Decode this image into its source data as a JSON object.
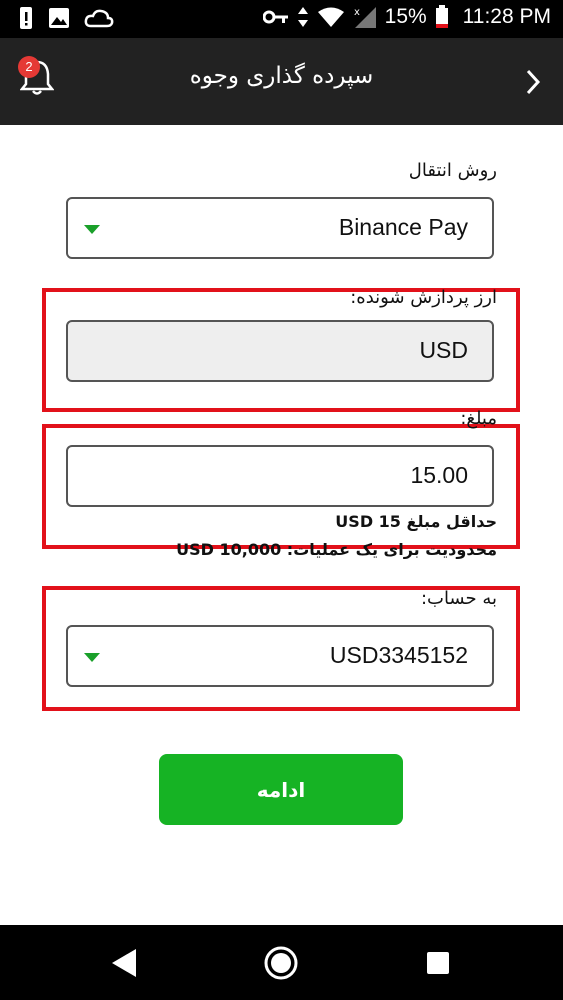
{
  "status_bar": {
    "battery_percent": "15%",
    "time": "11:28 PM"
  },
  "app_bar": {
    "title": "سپرده گذاری وجوه",
    "notification_count": "2"
  },
  "form": {
    "method_label": "روش انتقال",
    "method_value": "Binance Pay",
    "currency_label": "ارز پردازش شونده:",
    "currency_value": "USD",
    "amount_label": "مبلغ:",
    "amount_value": "15.00",
    "min_amount": "حداقل مبلغ USD 15",
    "max_amount": "محدودیت برای یک عملیات: USD 10,000",
    "account_label": "به حساب:",
    "account_value": "USD3345152"
  },
  "actions": {
    "continue_label": "ادامه"
  },
  "colors": {
    "accent_green": "#16b324",
    "highlight_red": "#e2111a",
    "app_bar": "#222222"
  }
}
